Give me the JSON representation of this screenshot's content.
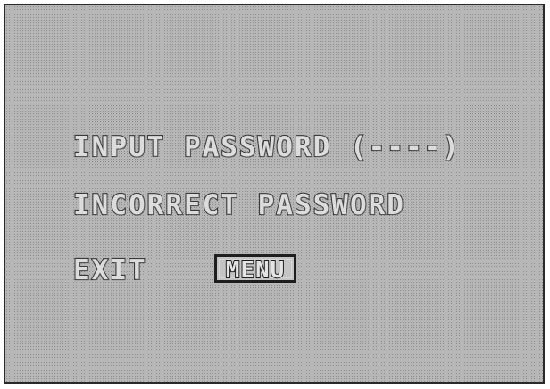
{
  "osd": {
    "password_prompt": "INPUT PASSWORD (----)",
    "error_message": "INCORRECT PASSWORD",
    "exit_label": "EXIT",
    "menu_button_label": "MENU"
  },
  "colors": {
    "panel_background": "#c9c9c9",
    "text_outline": "#3a3a3a",
    "text_fill": "#dcdcdc"
  }
}
